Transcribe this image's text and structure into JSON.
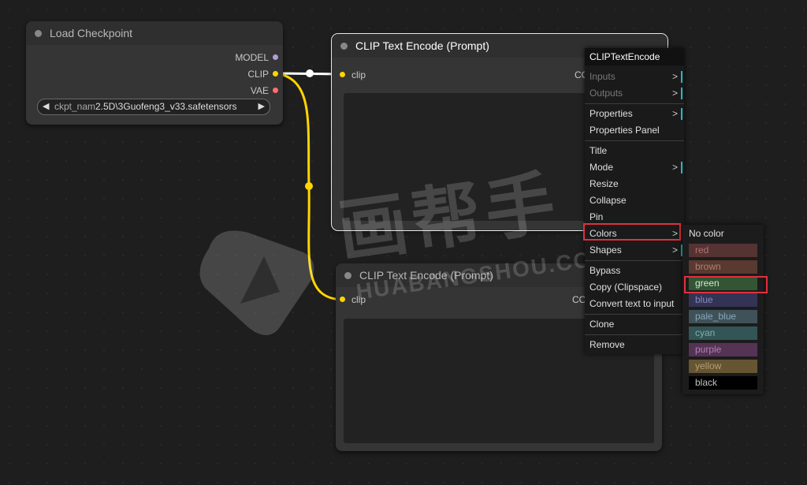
{
  "load_checkpoint": {
    "title": "Load Checkpoint",
    "outputs": [
      "MODEL",
      "CLIP",
      "VAE"
    ],
    "widget_name": "ckpt_nam",
    "widget_value": "2.5D\\3Guofeng3_v33.safetensors",
    "arrow_left": "◀",
    "arrow_right": "▶"
  },
  "clip_node_1": {
    "title": "CLIP Text Encode (Prompt)",
    "input": "clip",
    "output": "CO"
  },
  "clip_node_2": {
    "title": "CLIP Text Encode (Prompt)",
    "input": "clip",
    "output": "CO"
  },
  "context_menu": {
    "title": "CLIPTextEncode",
    "items": {
      "inputs": "Inputs",
      "outputs": "Outputs",
      "properties": "Properties",
      "properties_panel": "Properties Panel",
      "title": "Title",
      "mode": "Mode",
      "resize": "Resize",
      "collapse": "Collapse",
      "pin": "Pin",
      "colors": "Colors",
      "shapes": "Shapes",
      "bypass": "Bypass",
      "copy": "Copy (Clipspace)",
      "convert": "Convert text to input",
      "clone": "Clone",
      "remove": "Remove"
    },
    "arrow": ">"
  },
  "colors_menu": {
    "no_color": "No color",
    "options": [
      {
        "label": "red",
        "bg": "#553333",
        "fg": "#b07070"
      },
      {
        "label": "brown",
        "bg": "#593930",
        "fg": "#b08070"
      },
      {
        "label": "green",
        "bg": "#335533",
        "fg": "#d0e8d0"
      },
      {
        "label": "blue",
        "bg": "#333355",
        "fg": "#8888c0"
      },
      {
        "label": "pale_blue",
        "bg": "#3f5159",
        "fg": "#8aa8b8"
      },
      {
        "label": "cyan",
        "bg": "#335555",
        "fg": "#80b0b0"
      },
      {
        "label": "purple",
        "bg": "#553355",
        "fg": "#b080b0"
      },
      {
        "label": "yellow",
        "bg": "#665533",
        "fg": "#b0a070"
      },
      {
        "label": "black",
        "bg": "#000000",
        "fg": "#c0c0c0"
      }
    ]
  },
  "watermark": {
    "cn": "画帮手",
    "en": "HUABANGSHOU.COM"
  },
  "colors": {
    "clip_link": "#ffd500",
    "model_dot": "#b39ddb",
    "vae_dot": "#ff6e6e",
    "highlight": "#e0303c"
  }
}
